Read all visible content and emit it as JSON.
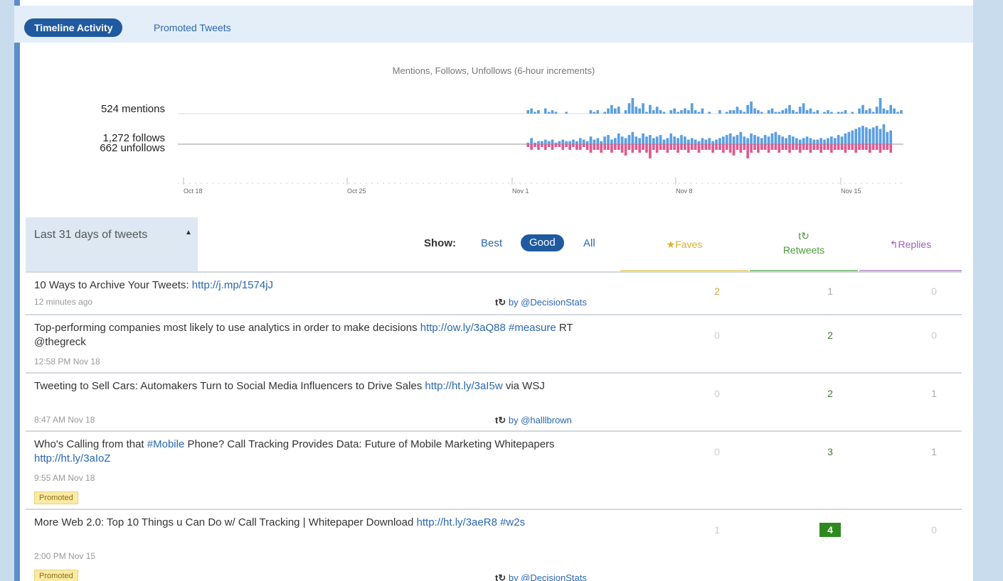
{
  "tabs": {
    "active": "Timeline Activity",
    "other": "Promoted Tweets"
  },
  "chart_data": {
    "type": "bar",
    "title": "Mentions, Follows, Unfollows (6-hour increments)",
    "row_labels": [
      "524 mentions",
      "1,272 follows",
      "662 unfollows"
    ],
    "x_tick_labels": [
      "Oct 18",
      "Oct 25",
      "Nov 1",
      "Nov 8",
      "Nov 15"
    ],
    "series": [
      {
        "name": "mentions",
        "values": [
          0,
          0,
          0,
          0,
          0,
          0,
          0,
          0,
          0,
          0,
          0,
          0,
          0,
          0,
          0,
          0,
          0,
          0,
          0,
          0,
          0,
          0,
          0,
          0,
          0,
          0,
          0,
          0,
          0,
          0,
          0,
          0,
          0,
          0,
          0,
          0,
          0,
          0,
          0,
          0,
          0,
          0,
          0,
          0,
          0,
          0,
          0,
          0,
          0,
          0,
          0,
          0,
          0,
          0,
          0,
          0,
          0,
          0,
          0,
          0,
          0,
          0,
          0,
          0,
          0,
          0,
          0,
          0,
          0,
          0,
          0,
          0,
          0,
          0,
          0,
          0,
          0,
          0,
          0,
          0,
          0,
          0,
          0,
          0,
          0,
          0,
          0,
          0,
          0,
          0,
          0,
          0,
          0,
          0,
          0,
          0,
          0,
          0,
          0,
          0,
          2,
          3,
          1,
          2,
          0,
          3,
          1,
          2,
          1,
          0,
          0,
          1,
          0,
          0,
          0,
          0,
          0,
          0,
          2,
          1,
          2,
          0,
          1,
          3,
          5,
          3,
          4,
          0,
          2,
          6,
          9,
          4,
          3,
          6,
          1,
          5,
          2,
          4,
          2,
          1,
          0,
          2,
          3,
          1,
          2,
          3,
          2,
          6,
          2,
          1,
          3,
          0,
          1,
          0,
          0,
          2,
          0,
          1,
          2,
          2,
          4,
          2,
          1,
          5,
          7,
          3,
          2,
          1,
          0,
          2,
          3,
          1,
          1,
          2,
          3,
          5,
          2,
          1,
          4,
          6,
          2,
          3,
          1,
          2,
          0,
          1,
          2,
          1,
          0,
          1,
          1,
          2,
          0,
          1,
          0,
          3,
          5,
          2,
          3,
          1,
          4,
          9,
          3,
          2,
          5,
          3,
          1,
          2
        ]
      },
      {
        "name": "follows",
        "values": [
          0,
          0,
          0,
          0,
          0,
          0,
          0,
          0,
          0,
          0,
          0,
          0,
          0,
          0,
          0,
          0,
          0,
          0,
          0,
          0,
          0,
          0,
          0,
          0,
          0,
          0,
          0,
          0,
          0,
          0,
          0,
          0,
          0,
          0,
          0,
          0,
          0,
          0,
          0,
          0,
          0,
          0,
          0,
          0,
          0,
          0,
          0,
          0,
          0,
          0,
          0,
          0,
          0,
          0,
          0,
          0,
          0,
          0,
          0,
          0,
          0,
          0,
          0,
          0,
          0,
          0,
          0,
          0,
          0,
          0,
          0,
          0,
          0,
          0,
          0,
          0,
          0,
          0,
          0,
          0,
          0,
          0,
          0,
          0,
          0,
          0,
          0,
          0,
          0,
          0,
          0,
          0,
          0,
          0,
          0,
          0,
          0,
          0,
          0,
          0,
          1,
          4,
          1,
          2,
          2,
          3,
          2,
          3,
          1,
          2,
          3,
          2,
          2,
          3,
          2,
          4,
          3,
          2,
          5,
          3,
          4,
          2,
          5,
          6,
          3,
          4,
          7,
          5,
          4,
          6,
          8,
          5,
          4,
          7,
          5,
          6,
          4,
          5,
          6,
          3,
          4,
          7,
          5,
          4,
          6,
          5,
          3,
          4,
          3,
          2,
          4,
          3,
          4,
          2,
          3,
          4,
          5,
          6,
          7,
          5,
          6,
          8,
          5,
          4,
          7,
          6,
          5,
          4,
          6,
          5,
          7,
          8,
          6,
          5,
          4,
          6,
          5,
          4,
          3,
          4,
          5,
          4,
          3,
          3,
          4,
          3,
          4,
          5,
          4,
          6,
          5,
          7,
          8,
          9,
          10,
          11,
          12,
          11,
          10,
          11,
          12,
          10,
          13,
          8,
          9
        ]
      },
      {
        "name": "unfollows",
        "values": [
          0,
          0,
          0,
          0,
          0,
          0,
          0,
          0,
          0,
          0,
          0,
          0,
          0,
          0,
          0,
          0,
          0,
          0,
          0,
          0,
          0,
          0,
          0,
          0,
          0,
          0,
          0,
          0,
          0,
          0,
          0,
          0,
          0,
          0,
          0,
          0,
          0,
          0,
          0,
          0,
          0,
          0,
          0,
          0,
          0,
          0,
          0,
          0,
          0,
          0,
          0,
          0,
          0,
          0,
          0,
          0,
          0,
          0,
          0,
          0,
          0,
          0,
          0,
          0,
          0,
          0,
          0,
          0,
          0,
          0,
          0,
          0,
          0,
          0,
          0,
          0,
          0,
          0,
          0,
          0,
          0,
          0,
          0,
          0,
          0,
          0,
          0,
          0,
          0,
          0,
          0,
          0,
          0,
          0,
          0,
          0,
          0,
          0,
          0,
          0,
          1,
          2,
          1,
          2,
          1,
          2,
          1,
          2,
          1,
          1,
          2,
          1,
          2,
          1,
          2,
          2,
          1,
          2,
          3,
          2,
          2,
          3,
          2,
          2,
          3,
          2,
          2,
          3,
          4,
          2,
          3,
          2,
          3,
          2,
          3,
          5,
          2,
          3,
          2,
          2,
          3,
          2,
          2,
          3,
          2,
          2,
          3,
          2,
          2,
          3,
          2,
          2,
          2,
          3,
          2,
          2,
          3,
          2,
          3,
          4,
          2,
          3,
          2,
          5,
          3,
          2,
          3,
          2,
          2,
          3,
          2,
          2,
          3,
          2,
          2,
          3,
          2,
          2,
          3,
          2,
          2,
          3,
          2,
          2,
          3,
          2,
          2,
          3,
          2,
          2,
          2,
          3,
          2,
          2,
          3,
          2,
          2,
          2,
          3,
          2,
          2,
          3,
          2,
          2,
          3
        ]
      }
    ],
    "ylim_mentions": [
      0,
      9
    ],
    "ylim_follows": [
      0,
      13
    ],
    "ylim_unfollows": [
      0,
      5
    ],
    "colors": {
      "mentions": "#5b9fe0",
      "follows": "#5b9fe0",
      "unfollows": "#e05a8f"
    }
  },
  "range": {
    "title": "Last 31 days of tweets"
  },
  "filters": {
    "show_label": "Show:",
    "best": "Best",
    "good": "Good",
    "all": "All"
  },
  "columns": {
    "faves": "Faves",
    "retweets_icon": "t↻",
    "retweets": "Retweets",
    "replies": "Replies"
  },
  "tweets": [
    {
      "text": "10 Ways to Archive Your Tweets: ",
      "link": "http://j.mp/1574jJ",
      "time": "12 minutes ago",
      "by": "by @DecisionStats",
      "faves": "2",
      "retweets": "1",
      "replies": "0"
    },
    {
      "text": "Top-performing companies most likely to use analytics in order to make decisions ",
      "link": "http://ow.ly/3aQ88",
      "hashtag": "#measure",
      "tail": " RT @thegreck",
      "time": "12:58 PM Nov 18",
      "faves": "0",
      "retweets": "2",
      "replies": "0"
    },
    {
      "text": "Tweeting to Sell Cars: Automakers Turn to Social Media Influencers to Drive Sales ",
      "link": "http://ht.ly/3aI5w",
      "tail": " via WSJ",
      "time": "8:47 AM Nov 18",
      "by": "by @halllbrown",
      "faves": "0",
      "retweets": "2",
      "replies": "1"
    },
    {
      "text": "Who's Calling from that ",
      "hashtag": "#Mobile",
      "tail": " Phone? Call Tracking Provides Data: Future of Mobile Marketing Whitepapers ",
      "link": "http://ht.ly/3aIoZ",
      "time": "9:55 AM Nov 18",
      "badge": "Promoted",
      "faves": "0",
      "retweets": "3",
      "replies": "1"
    },
    {
      "text": "More Web 2.0: Top 10 Things u Can Do w/ Call Tracking | Whitepaper Download ",
      "link": "http://ht.ly/3aeR8",
      "hashtag": "#w2s",
      "time": "2:00 PM Nov 15",
      "badge": "Promoted",
      "by": "by @DecisionStats",
      "faves": "1",
      "retweets": "4",
      "replies": "0"
    }
  ]
}
